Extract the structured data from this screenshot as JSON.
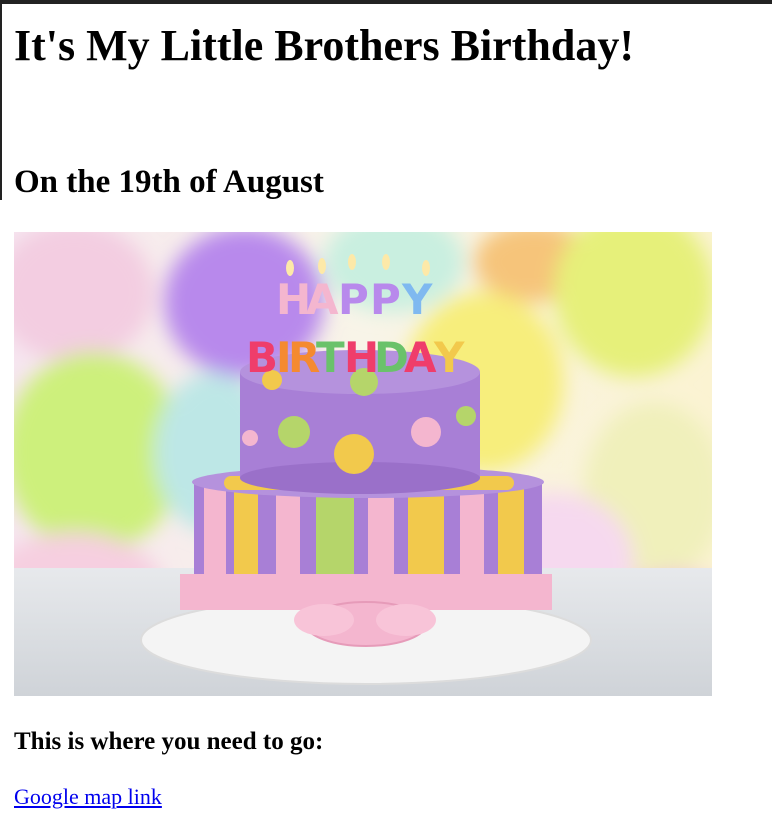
{
  "page": {
    "title": "It's My Little Brothers Birthday!",
    "date_heading": "On the 19th of August",
    "cake_image": {
      "alt": "Birthday cake",
      "candle_letters": [
        "H",
        "A",
        "P",
        "P",
        "Y",
        "B",
        "I",
        "R",
        "T",
        "H",
        "D",
        "A",
        "Y"
      ]
    },
    "directions_heading": "This is where you need to go:",
    "map_link_text": "Google map link"
  },
  "colors": {
    "link": "#0000ee",
    "cake_purple": "#a87fd6",
    "cake_pink": "#f4b6cf",
    "cake_yellow": "#f2c94c",
    "cake_green": "#b5d56a"
  }
}
